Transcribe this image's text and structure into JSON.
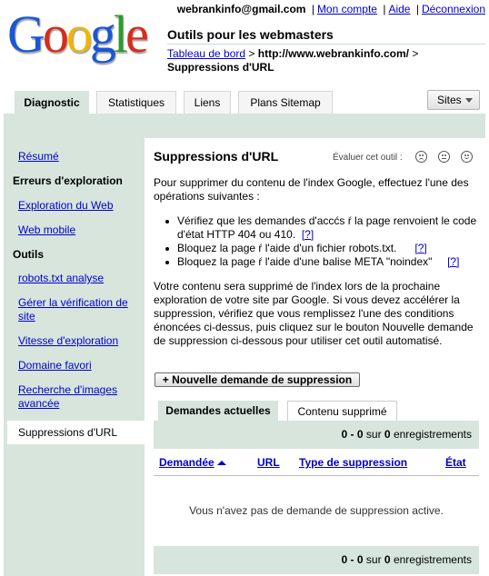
{
  "brand": {
    "logo_text": "Google",
    "app_title": "Outils pour les webmasters"
  },
  "header": {
    "email": "webrankinfo@gmail.com",
    "links": [
      "Mon compte",
      "Aide",
      "Déconnexion"
    ],
    "breadcrumb": {
      "home": "Tableau de bord",
      "site": "http://www.webrankinfo.com/",
      "separator": ">",
      "current": "Suppressions d'URL"
    }
  },
  "tabs": [
    {
      "label": "Diagnostic",
      "active": true
    },
    {
      "label": "Statistiques",
      "active": false
    },
    {
      "label": "Liens",
      "active": false
    },
    {
      "label": "Plans Sitemap",
      "active": false
    }
  ],
  "sites_button": "Sites",
  "sidebar": {
    "items": [
      {
        "type": "link",
        "label": "Résumé"
      },
      {
        "type": "heading",
        "label": "Erreurs d'exploration"
      },
      {
        "type": "link",
        "label": "Exploration du Web"
      },
      {
        "type": "link",
        "label": "Web mobile"
      },
      {
        "type": "heading",
        "label": "Outils"
      },
      {
        "type": "link",
        "label": "robots.txt analyse"
      },
      {
        "type": "link",
        "label": "Gérer la vérification de site"
      },
      {
        "type": "link",
        "label": "Vitesse d'exploration"
      },
      {
        "type": "link",
        "label": "Domaine favori"
      },
      {
        "type": "link",
        "label": "Recherche d'images avancée"
      },
      {
        "type": "selected",
        "label": "Suppressions d'URL"
      }
    ]
  },
  "main": {
    "heading": "Suppressions d'URL",
    "rate_label": "Évaluer cet outil :",
    "intro": "Pour supprimer du contenu de l'index Google, effectuez l'une des opérations suivantes :",
    "bullets": [
      {
        "text": "Vérifiez que les demandes d'accćs ŕ la page renvoient le code d'état HTTP 404 ou 410.",
        "help": "[?]"
      },
      {
        "text": "Bloquez la page ŕ l'aide d'un fichier robots.txt.",
        "help": "[?]"
      },
      {
        "text": "Bloquez la page ŕ l'aide d'une balise META \"noindex\"",
        "help": "[?]"
      }
    ],
    "paragraph": "Votre contenu sera supprimé de l'index lors de la prochaine exploration de votre site par Google. Si vous devez accélérer la suppression, vérifiez que vous remplissez l'une des conditions énoncées ci-dessus, puis cliquez sur le bouton Nouvelle demande de suppression ci-dessous pour utiliser cet outil automatisé.",
    "new_request_button": "+ Nouvelle demande de suppression",
    "inner_tabs": [
      "Demandes actuelles",
      "Contenu supprimé"
    ],
    "pager": {
      "range": "0 - 0",
      "sur": "sur",
      "count": "0",
      "unit": "enregistrements"
    },
    "columns": [
      "Demandée",
      "URL",
      "Type de suppression",
      "État"
    ],
    "empty_message": "Vous n'avez pas de demande de suppression active."
  },
  "colors": {
    "accent_green": "#d7e5dc",
    "link": "#0000cc"
  }
}
